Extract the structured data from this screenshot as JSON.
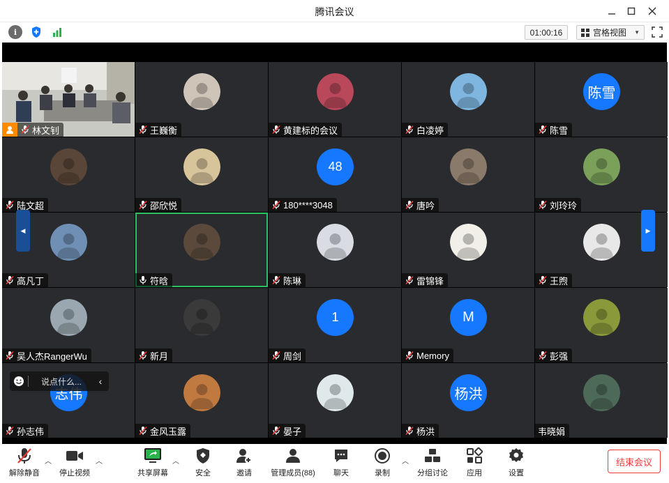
{
  "window": {
    "title": "腾讯会议"
  },
  "infobar": {
    "timer": "01:00:16",
    "view_mode": "宫格视图"
  },
  "participants": [
    {
      "name": "林文钊",
      "avatar": "camera",
      "host": true
    },
    {
      "name": "王巍衡",
      "avatar": "photo",
      "color": "#cfc4b8"
    },
    {
      "name": "黄建标的会议",
      "avatar": "photo",
      "color": "#b8485a"
    },
    {
      "name": "白凌婷",
      "avatar": "photo",
      "color": "#7fb6e0"
    },
    {
      "name": "陈雪",
      "avatar": "text",
      "avatar_text": "陈雪"
    },
    {
      "name": "陆文超",
      "avatar": "photo",
      "color": "#5a4638"
    },
    {
      "name": "邵欣悦",
      "avatar": "photo",
      "color": "#d7c49a"
    },
    {
      "name": "180****3048",
      "avatar": "num",
      "avatar_text": "48"
    },
    {
      "name": "唐吟",
      "avatar": "photo",
      "color": "#8a7a6a"
    },
    {
      "name": "刘玲玲",
      "avatar": "photo",
      "color": "#7aa05a"
    },
    {
      "name": "高凡丁",
      "avatar": "photo",
      "color": "#6f8fb5"
    },
    {
      "name": "符晗",
      "avatar": "photo",
      "color": "#5b4a3c",
      "active": true,
      "mic_on": true
    },
    {
      "name": "陈琳",
      "avatar": "photo",
      "color": "#d9dde3"
    },
    {
      "name": "雷锦锋",
      "avatar": "photo",
      "color": "#f2efe9"
    },
    {
      "name": "王煦",
      "avatar": "photo",
      "color": "#e8e8e8"
    },
    {
      "name": "吴人杰RangerWu",
      "avatar": "photo",
      "color": "#9aa7b0"
    },
    {
      "name": "新月",
      "avatar": "photo",
      "color": "#3a3a3a"
    },
    {
      "name": "周剑",
      "avatar": "num",
      "avatar_text": "1"
    },
    {
      "name": "Memory",
      "avatar": "text",
      "avatar_text": "M"
    },
    {
      "name": "彭强",
      "avatar": "photo",
      "color": "#8a9a3a"
    },
    {
      "name": "孙志伟",
      "avatar": "text",
      "avatar_text": "志伟"
    },
    {
      "name": "金风玉露",
      "avatar": "photo",
      "color": "#c07a40"
    },
    {
      "name": "晏子",
      "avatar": "photo",
      "color": "#dfe8ea"
    },
    {
      "name": "杨洪",
      "avatar": "text",
      "avatar_text": "杨洪"
    },
    {
      "name": "韦晓娟",
      "avatar": "photo",
      "color": "#4d6a58",
      "no_mic": true
    }
  ],
  "chat": {
    "placeholder": "说点什么..."
  },
  "toolbar": {
    "unmute": "解除静音",
    "stop_video": "停止视频",
    "share_screen": "共享屏幕",
    "security": "安全",
    "invite": "邀请",
    "manage_members": "管理成员(88)",
    "chat": "聊天",
    "record": "录制",
    "breakout": "分组讨论",
    "apps": "应用",
    "settings": "设置",
    "end_meeting": "结束会议"
  },
  "colors": {
    "accent": "#1677ff",
    "active_border": "#2bc164",
    "danger": "#f03a3a",
    "host_badge": "#ff8a00"
  }
}
